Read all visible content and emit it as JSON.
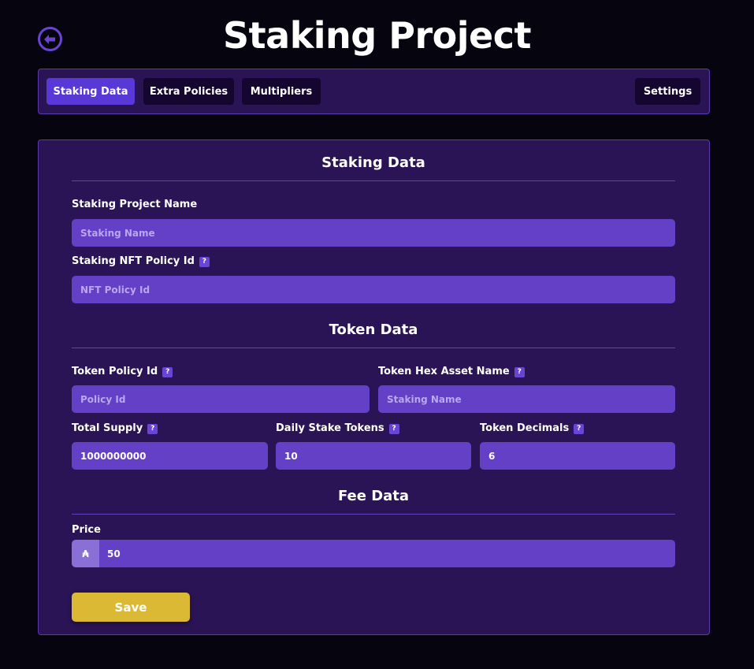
{
  "header": {
    "title": "Staking Project",
    "back_icon": "arrow-left-circle-icon"
  },
  "tabs": [
    {
      "label": "Staking Data",
      "active": true
    },
    {
      "label": "Extra Policies",
      "active": false
    },
    {
      "label": "Multipliers",
      "active": false
    },
    {
      "label": "Settings",
      "active": false
    }
  ],
  "staking_data": {
    "title": "Staking Data",
    "project_name": {
      "label": "Staking Project Name",
      "placeholder": "Staking Name",
      "value": ""
    },
    "nft_policy_id": {
      "label": "Staking NFT Policy Id",
      "help": "?",
      "placeholder": "NFT Policy Id",
      "value": ""
    }
  },
  "token_data": {
    "title": "Token Data",
    "policy_id": {
      "label": "Token Policy Id",
      "help": "?",
      "placeholder": "Policy Id",
      "value": ""
    },
    "hex_asset_name": {
      "label": "Token Hex Asset Name",
      "help": "?",
      "placeholder": "Staking Name",
      "value": ""
    },
    "total_supply": {
      "label": "Total Supply",
      "help": "?",
      "value": "1000000000"
    },
    "daily_stake_tokens": {
      "label": "Daily Stake Tokens",
      "help": "?",
      "value": "10"
    },
    "decimals": {
      "label": "Token Decimals",
      "help": "?",
      "value": "6"
    }
  },
  "fee_data": {
    "title": "Fee Data",
    "price": {
      "label": "Price",
      "prefix": "₳",
      "value": "50"
    }
  },
  "actions": {
    "save_label": "Save"
  },
  "colors": {
    "background": "#05040f",
    "panel": "#2a1455",
    "input": "#6440c6",
    "active_tab": "#5839d8",
    "save_button": "#dcb935"
  }
}
